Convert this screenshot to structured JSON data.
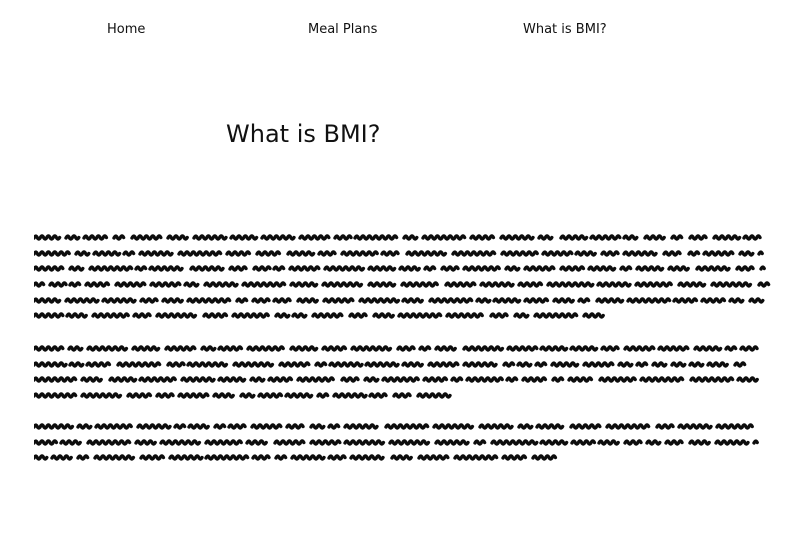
{
  "nav": {
    "home_label": "Home",
    "meal_plans_label": "Meal Plans",
    "bmi_label": "What is BMI?"
  },
  "page": {
    "title": "What is BMI?"
  },
  "body_paragraphs": [
    {
      "line_widths": [
        729,
        728,
        729,
        740,
        729,
        577
      ]
    },
    {
      "line_widths": [
        725,
        713,
        724,
        418
      ]
    },
    {
      "line_widths": [
        724,
        721,
        523
      ]
    }
  ],
  "colors": {
    "text": "#111111",
    "background": "#ffffff",
    "scribble": "#0d0d0d"
  }
}
